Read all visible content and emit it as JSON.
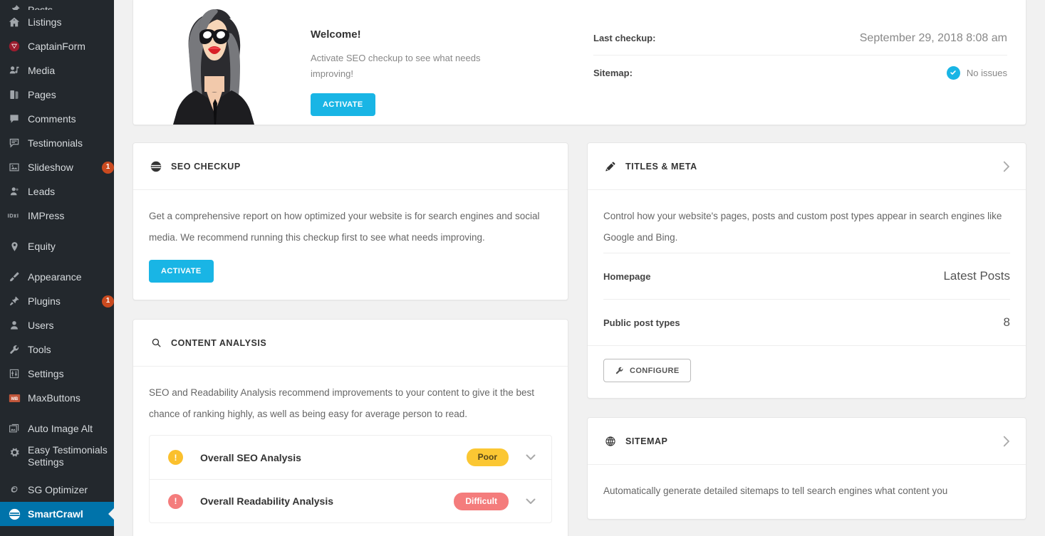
{
  "sidebar": {
    "items": [
      {
        "label": "Posts",
        "icon": "pin-icon",
        "partial": true,
        "badge": null,
        "active": false,
        "sep_after": false
      },
      {
        "label": "Listings",
        "icon": "home-icon",
        "partial": false,
        "badge": null,
        "active": false,
        "sep_after": false
      },
      {
        "label": "CaptainForm",
        "icon": "captainform-icon",
        "partial": false,
        "badge": null,
        "active": false,
        "sep_after": false
      },
      {
        "label": "Media",
        "icon": "media-icon",
        "partial": false,
        "badge": null,
        "active": false,
        "sep_after": false
      },
      {
        "label": "Pages",
        "icon": "pages-icon",
        "partial": false,
        "badge": null,
        "active": false,
        "sep_after": false
      },
      {
        "label": "Comments",
        "icon": "comment-icon",
        "partial": false,
        "badge": null,
        "active": false,
        "sep_after": false
      },
      {
        "label": "Testimonials",
        "icon": "testimonials-icon",
        "partial": false,
        "badge": null,
        "active": false,
        "sep_after": false
      },
      {
        "label": "Slideshow",
        "icon": "image-icon",
        "partial": false,
        "badge": "1",
        "active": false,
        "sep_after": false
      },
      {
        "label": "Leads",
        "icon": "user-icon",
        "partial": false,
        "badge": null,
        "active": false,
        "sep_after": false
      },
      {
        "label": "IMPress",
        "icon": "impress-icon",
        "partial": false,
        "badge": null,
        "active": false,
        "sep_after": true
      },
      {
        "label": "Equity",
        "icon": "pin-location-icon",
        "partial": false,
        "badge": null,
        "active": false,
        "sep_after": true
      },
      {
        "label": "Appearance",
        "icon": "brush-icon",
        "partial": false,
        "badge": null,
        "active": false,
        "sep_after": false
      },
      {
        "label": "Plugins",
        "icon": "plug-icon",
        "partial": false,
        "badge": "1",
        "active": false,
        "sep_after": false
      },
      {
        "label": "Users",
        "icon": "users-icon",
        "partial": false,
        "badge": null,
        "active": false,
        "sep_after": false
      },
      {
        "label": "Tools",
        "icon": "wrench-icon",
        "partial": false,
        "badge": null,
        "active": false,
        "sep_after": false
      },
      {
        "label": "Settings",
        "icon": "sliders-icon",
        "partial": false,
        "badge": null,
        "active": false,
        "sep_after": false
      },
      {
        "label": "MaxButtons",
        "icon": "maxbuttons-icon",
        "partial": false,
        "badge": null,
        "active": false,
        "sep_after": true
      },
      {
        "label": "Auto Image Alt",
        "icon": "images-icon",
        "partial": false,
        "badge": null,
        "active": false,
        "sep_after": false
      },
      {
        "label": "Easy Testimonials Settings",
        "icon": "gear-icon",
        "partial": false,
        "badge": null,
        "active": false,
        "sep_after": false,
        "tall": true
      },
      {
        "label": "SG Optimizer",
        "icon": "sg-icon",
        "partial": false,
        "badge": null,
        "active": false,
        "sep_after": false
      },
      {
        "label": "SmartCrawl",
        "icon": "smartcrawl-icon",
        "partial": false,
        "badge": null,
        "active": true,
        "sep_after": false
      }
    ]
  },
  "welcome": {
    "title": "Welcome!",
    "description": "Activate SEO checkup to see what needs improving!",
    "activate_label": "ACTIVATE",
    "avatar_name": "smartcrawl-mascot",
    "last_checkup_label": "Last checkup:",
    "last_checkup_value": "September 29, 2018 8:08 am",
    "sitemap_label": "Sitemap:",
    "sitemap_status": "No issues",
    "sitemap_status_icon": "check-circle-icon"
  },
  "seo_checkup": {
    "title": "SEO CHECKUP",
    "icon": "smartcrawl-icon",
    "body": "Get a comprehensive report on how optimized your website is for search engines and social media. We recommend running this checkup first to see what needs improving.",
    "activate_label": "ACTIVATE"
  },
  "content_analysis": {
    "title": "CONTENT ANALYSIS",
    "icon": "search-icon",
    "body": "SEO and Readability Analysis recommend improvements to your content to give it the best chance of ranking highly, as well as being easy for average person to read.",
    "rows": [
      {
        "label": "Overall SEO Analysis",
        "status": "Poor",
        "dot_color": "#fbc02d",
        "pill_bg": "#fbc733",
        "pill_text_color": "#55461a",
        "dot_icon": "warning-icon"
      },
      {
        "label": "Overall Readability Analysis",
        "status": "Difficult",
        "dot_color": "#f47c7c",
        "pill_bg": "#f47c7c",
        "pill_text_color": "#ffffff",
        "dot_icon": "warning-icon"
      }
    ]
  },
  "titles_meta": {
    "title": "TITLES & META",
    "icon": "pencil-icon",
    "body": "Control how your website's pages, posts and custom post types appear in search engines like Google and Bing.",
    "rows": [
      {
        "key": "Homepage",
        "value": "Latest Posts"
      },
      {
        "key": "Public post types",
        "value": "8"
      }
    ],
    "configure_label": "CONFIGURE",
    "configure_icon": "wrench-icon",
    "expand_icon": "chevron-right-icon"
  },
  "sitemap": {
    "title": "SITEMAP",
    "icon": "globe-icon",
    "body": "Automatically generate detailed sitemaps to tell search engines what content you",
    "expand_icon": "chevron-right-icon"
  },
  "colors": {
    "sidebar_bg": "#23282d",
    "sidebar_active": "#0073aa",
    "accent_blue": "#19b5e5",
    "badge_orange": "#ca4a1f",
    "page_bg": "#f1f1f1"
  }
}
